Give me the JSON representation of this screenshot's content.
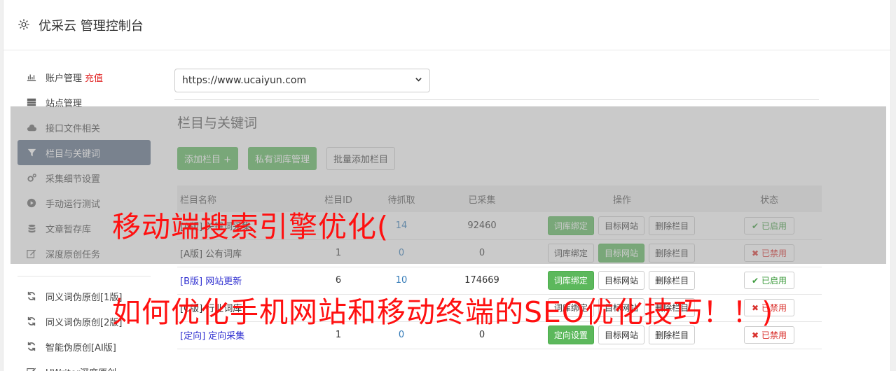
{
  "header": {
    "title": "优采云 管理控制台"
  },
  "sidebar": {
    "items": [
      {
        "label": "账户管理",
        "extra": "充值",
        "icon": "bar-chart-icon"
      },
      {
        "label": "站点管理",
        "icon": "server-icon"
      },
      {
        "label": "接口文件相关",
        "icon": "cloud-upload-icon"
      },
      {
        "label": "栏目与关键词",
        "icon": "filter-icon",
        "active": true
      },
      {
        "label": "采集细节设置",
        "icon": "cogs-icon"
      },
      {
        "label": "手动运行测试",
        "icon": "play-circle-icon"
      },
      {
        "label": "文章暂存库",
        "icon": "database-icon"
      },
      {
        "label": "深度原创任务",
        "icon": "edit-icon"
      }
    ],
    "items2": [
      {
        "label": "同义词伪原创[1版]",
        "icon": "refresh-icon"
      },
      {
        "label": "同义词伪原创[2版]",
        "icon": "refresh-icon"
      },
      {
        "label": "智能伪原创[AI版]",
        "icon": "refresh-icon"
      },
      {
        "label": "UWriter深度原创",
        "icon": "edit-icon"
      }
    ]
  },
  "main": {
    "site_select": "https://www.ucaiyun.com",
    "section_title": "栏目与关键词",
    "buttons": {
      "add_column": "添加栏目 +",
      "private_lib": "私有词库管理",
      "batch_add": "批量添加栏目"
    },
    "table": {
      "headers": [
        "栏目名称",
        "栏目ID",
        "待抓取",
        "已采集",
        "操作",
        "状态"
      ],
      "rows": [
        {
          "name": "[A版] 关键词采集",
          "id": "",
          "pending": "14",
          "collected": "92460",
          "op1": "词库绑定",
          "op2": "目标网站",
          "op3": "删除栏目",
          "status": "已启用"
        },
        {
          "name": "[A版] 公有词库",
          "id": "1",
          "pending": "0",
          "collected": "0",
          "op1": "词库绑定",
          "op2": "目标网站",
          "op3": "删除栏目",
          "status": "已禁用"
        },
        {
          "name": "[B版] 网站更新",
          "id": "6",
          "pending": "10",
          "collected": "174669",
          "op1": "词库绑定",
          "op2": "目标网站",
          "op3": "删除栏目",
          "status": "已启用"
        },
        {
          "name": "[C版] 行业词库",
          "id": "",
          "pending": "",
          "collected": "",
          "op1": "词库绑定",
          "op2": "目标网站",
          "op3": "删除栏目",
          "status": "已禁用"
        },
        {
          "name": "[定向] 定向采集",
          "id": "1",
          "pending": "0",
          "collected": "0",
          "op1": "定向设置",
          "op2": "目标网站",
          "op3": "删除栏目",
          "status": "已禁用"
        }
      ]
    }
  },
  "captions": {
    "line1": "移动端搜索引擎优化(",
    "line2": "如何优化手机网站和移动终端的SEO优化技巧！！)"
  },
  "colors": {
    "accent_green": "#5cb85c",
    "nav_active": "#5c6e87",
    "caption_red": "#ff1010"
  }
}
